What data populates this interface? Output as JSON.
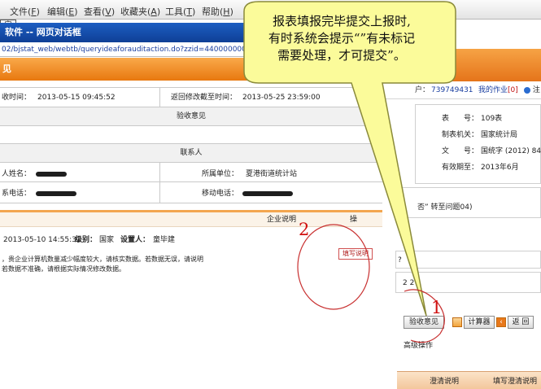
{
  "browser": {
    "menu": [
      {
        "label": "文件(",
        "key": "F",
        "close": ")"
      },
      {
        "label": "编辑(",
        "key": "E",
        "close": ")"
      },
      {
        "label": "查看(",
        "key": "V",
        "close": ")"
      },
      {
        "label": "收藏夹(",
        "key": "A",
        "close": ")"
      },
      {
        "label": "工具(",
        "key": "T",
        "close": ")"
      },
      {
        "label": "帮助(",
        "key": "H",
        "close": ")"
      }
    ],
    "ok_tag": "定",
    "dialog_title": "软件 -- 网页对话框",
    "url": "02/bjstat_web/webtb/queryideaforauditaction.do?zzid=4400000000000"
  },
  "dialog": {
    "strip_title": "见",
    "receive_time_label": "收时间：",
    "receive_time": "2013-05-15 09:45:52",
    "return_deadline_label": "返回修改截至时间：",
    "return_deadline": "2013-05-25 23:59:00",
    "acceptance_header": "验收意见",
    "contact_header": "联系人",
    "name_label": "人姓名：",
    "unit_label": "所属单位：",
    "unit_value": "夏港街道统计站",
    "phone_label": "系电话：",
    "mobile_label": "移动电话：",
    "enterprise_note": "企业说明",
    "note_partial": "操",
    "record_time": "2013-05-10 14:55:31",
    "level_label": "级别：",
    "level_value": "国家",
    "setter_label": "设置人：",
    "setter_value": "童毕建",
    "line1": "，贵企业计算机数量减少幅度较大，请核实数据。若数据无误，请说明",
    "line2": "若数据不准确，请根据实际情况修改数据。",
    "write_button": "填写说明"
  },
  "right_panel": {
    "user_label": "户：",
    "user_id": "739749431",
    "my_work_label": "我的作业",
    "my_work_count": "[0]",
    "exit_glyph": "注",
    "form_no_label": "表　　号：",
    "form_no": "109表",
    "org_label": "制表机关：",
    "org": "国家统计局",
    "doc_label": "文　　号：",
    "doc": "国统字 (2012) 84号",
    "valid_label": "有效期至：",
    "valid": "2013年6月",
    "goto_text": "否” 转至问题04)",
    "q_mark": "?",
    "num_text": "2 2",
    "btn_accept": "验收意见",
    "btn_calc": "计算器",
    "btn_back": "返 回",
    "advanced": "高级操作",
    "clarify": "澄清说明",
    "fill_clarify": "填写澄清说明"
  },
  "callout": {
    "line1": "报表填报完毕提交上报时,",
    "line2": "有时系统会提示“”有未标记",
    "line3": "需要处理，才可提交”。",
    "marker1": "1",
    "marker2": "2"
  }
}
